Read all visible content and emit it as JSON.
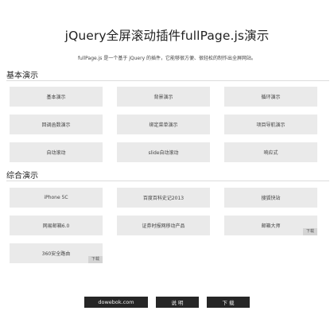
{
  "header": {
    "title": "jQuery全屏滚动插件fullPage.js演示",
    "subtitle": "fullPage.js 是一个基于 jQuery 的插件，它能够很方便、很轻松的制作出全屏网站。"
  },
  "sections": [
    {
      "title": "基本演示",
      "items": [
        {
          "label": "基本演示"
        },
        {
          "label": "背景演示"
        },
        {
          "label": "循环演示"
        },
        {
          "label": "回调函数演示"
        },
        {
          "label": "绑定菜单演示"
        },
        {
          "label": "项目导航演示"
        },
        {
          "label": "自动滚动"
        },
        {
          "label": "slide自动滚动"
        },
        {
          "label": "响应式"
        }
      ]
    },
    {
      "title": "综合演示",
      "items": [
        {
          "label": "iPhone 5C"
        },
        {
          "label": "百度百科史记2013"
        },
        {
          "label": "搜狐快站"
        },
        {
          "label": "网易邮箱6.0"
        },
        {
          "label": "证券时报网移动产品"
        },
        {
          "label": "邮箱大师",
          "tag": "下载"
        },
        {
          "label": "360安全路由",
          "tag": "下载"
        }
      ]
    }
  ],
  "footer": {
    "buttons": [
      {
        "label": "dowebok.com"
      },
      {
        "label": "说 明"
      },
      {
        "label": "下 载"
      }
    ]
  }
}
